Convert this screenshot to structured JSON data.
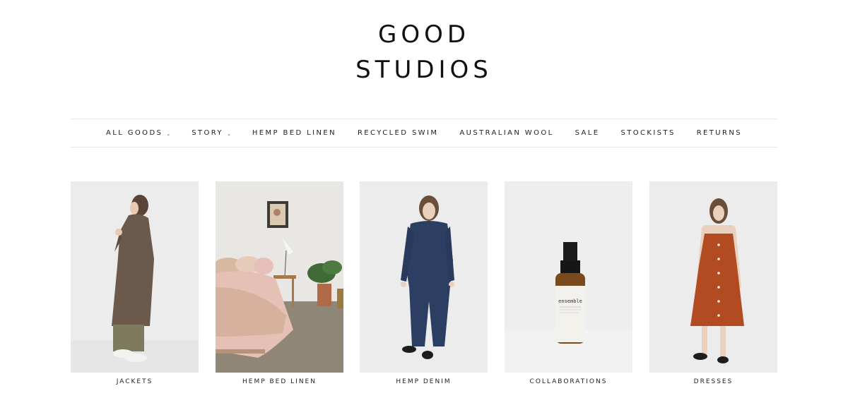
{
  "brand": {
    "line1": "GOOD",
    "line2": "STUDIOS"
  },
  "nav": {
    "items": [
      {
        "label": "ALL GOODS",
        "dropdown": true
      },
      {
        "label": "STORY",
        "dropdown": true
      },
      {
        "label": "HEMP BED LINEN",
        "dropdown": false
      },
      {
        "label": "RECYCLED SWIM",
        "dropdown": false
      },
      {
        "label": "AUSTRALIAN WOOL",
        "dropdown": false
      },
      {
        "label": "SALE",
        "dropdown": false
      },
      {
        "label": "STOCKISTS",
        "dropdown": false
      },
      {
        "label": "RETURNS",
        "dropdown": false
      }
    ]
  },
  "categories": [
    {
      "label": "JACKETS"
    },
    {
      "label": "HEMP BED LINEN"
    },
    {
      "label": "HEMP DENIM"
    },
    {
      "label": "COLLABORATIONS",
      "bottle_text": "ensemble"
    },
    {
      "label": "DRESSES"
    }
  ],
  "colors": {
    "photo_bg": "#ebebeb",
    "coat": "#6b5a4b",
    "denim": "#2d3e63",
    "dress": "#b24a22",
    "linen_pink": "#e4c1b4"
  }
}
